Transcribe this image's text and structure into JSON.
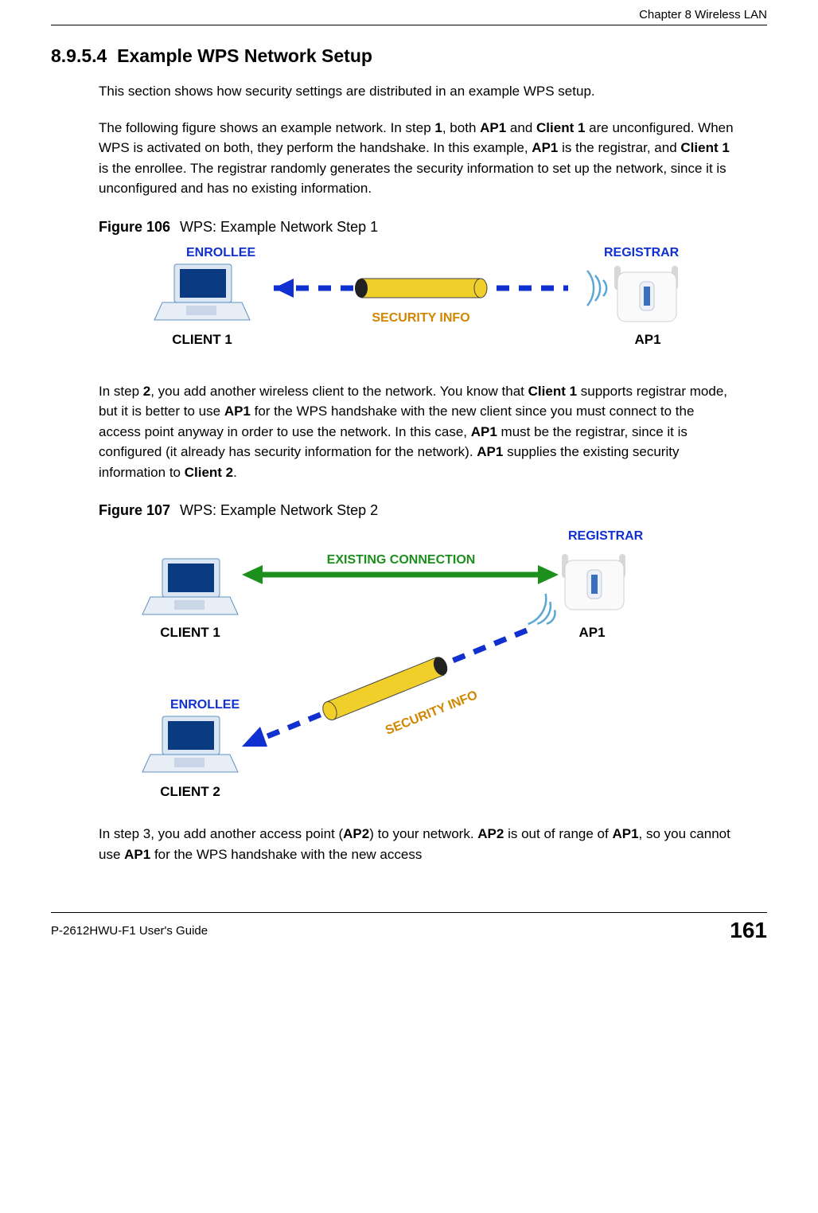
{
  "header": {
    "chapter": "Chapter 8 Wireless LAN"
  },
  "section": {
    "number": "8.9.5.4",
    "title": "Example WPS Network Setup"
  },
  "paragraphs": {
    "p1": "This section shows how security settings are distributed in an example WPS setup.",
    "p2a": "The following figure shows an example network. In step ",
    "p2_step": "1",
    "p2b": ", both ",
    "p2_ap1": "AP1",
    "p2c": " and ",
    "p2_client1": "Client 1",
    "p2d": " are unconfigured. When WPS is activated on both, they perform the handshake. In this example, ",
    "p2_ap1b": "AP1",
    "p2e": " is the registrar, and ",
    "p2_client1b": "Client 1",
    "p2f": " is the enrollee. The registrar randomly generates the security information to set up the network, since it is unconfigured and has no existing information.",
    "p3a": "In step ",
    "p3_step": "2",
    "p3b": ", you add another wireless client to the network. You know that ",
    "p3_client1": "Client 1",
    "p3c": " supports registrar mode, but it is better to use ",
    "p3_ap1": "AP1",
    "p3d": " for the WPS handshake with the new client since you must connect to the access point anyway in order to use the network. In this case, ",
    "p3_ap1b": "AP1",
    "p3e": " must be the registrar, since it is configured (it already has security information for the network). ",
    "p3_ap1c": "AP1",
    "p3f": " supplies the existing security information to ",
    "p3_client2": "Client 2",
    "p3g": ".",
    "p4a": "In step 3, you add another access point (",
    "p4_ap2": "AP2",
    "p4b": ") to your network. ",
    "p4_ap2b": "AP2",
    "p4c": " is out of range of ",
    "p4_ap1": "AP1",
    "p4d": ", so you cannot use ",
    "p4_ap1b": "AP1",
    "p4e": " for the WPS handshake with the new access"
  },
  "figures": {
    "f106": {
      "label": "Figure 106",
      "caption": "WPS: Example Network Step 1",
      "labels": {
        "enrollee": "ENROLLEE",
        "registrar": "REGISTRAR",
        "client1": "CLIENT 1",
        "ap1": "AP1",
        "secinfo": "SECURITY INFO"
      }
    },
    "f107": {
      "label": "Figure 107",
      "caption": "WPS: Example Network Step 2",
      "labels": {
        "enrollee": "ENROLLEE",
        "registrar": "REGISTRAR",
        "client1": "CLIENT 1",
        "client2": "CLIENT 2",
        "ap1": "AP1",
        "existing": "EXISTING CONNECTION",
        "secinfo": "SECURITY INFO"
      }
    }
  },
  "footer": {
    "guide": "P-2612HWU-F1 User's Guide",
    "page": "161"
  },
  "colors": {
    "blue": "#1030d0",
    "orange": "#d28600",
    "green": "#1d8f1d",
    "yellow": "#f0cf2a"
  }
}
